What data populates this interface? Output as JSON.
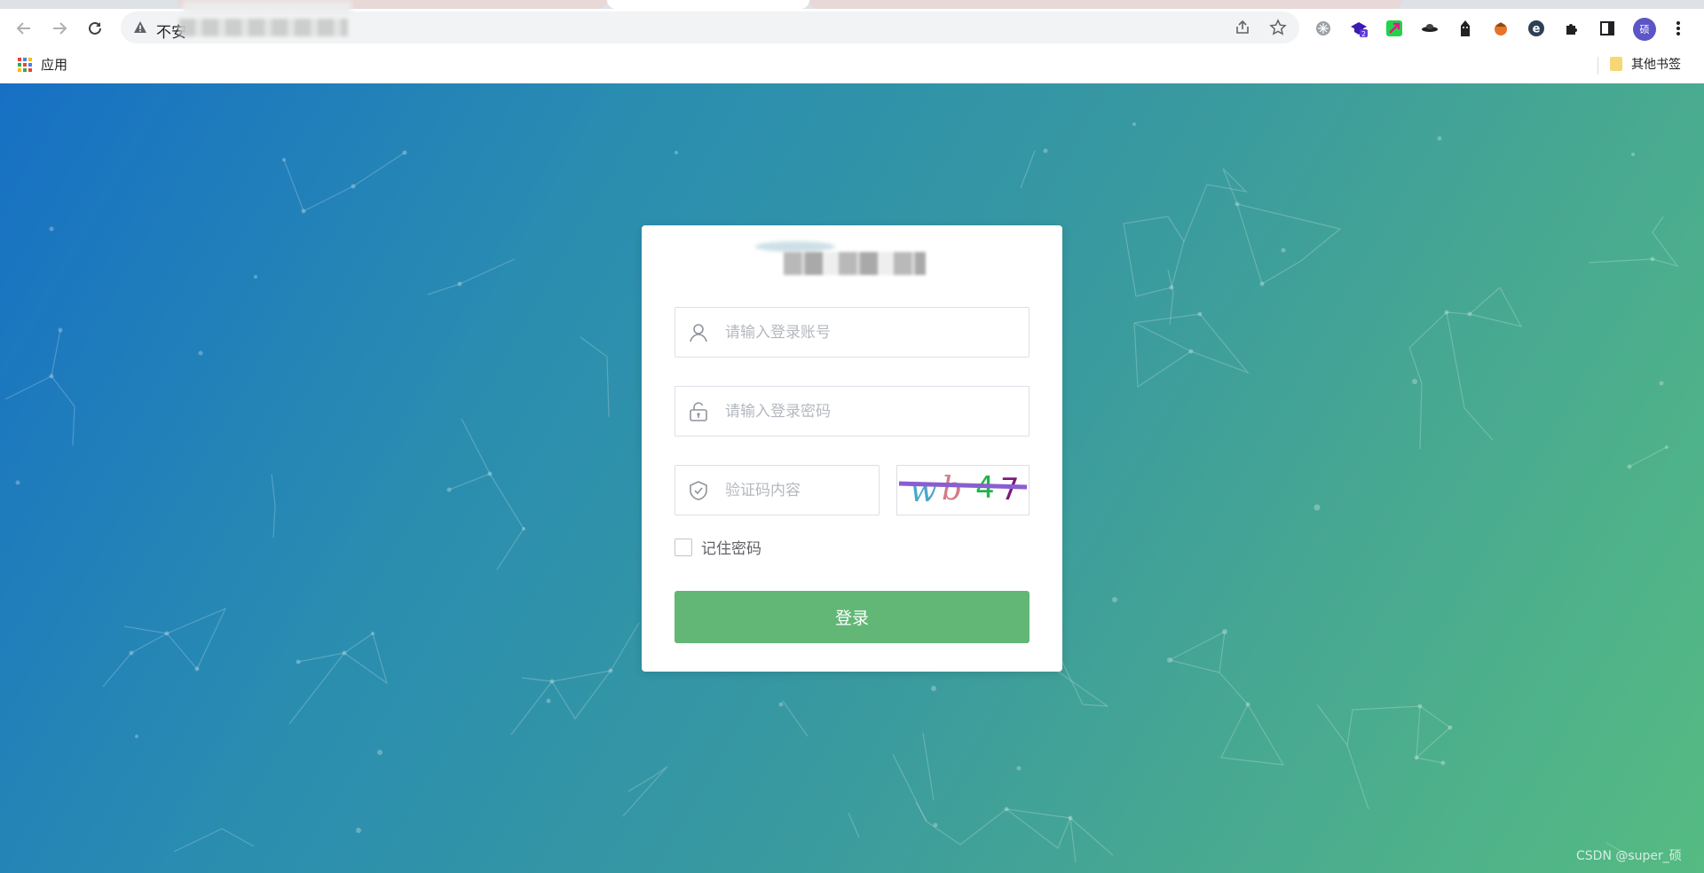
{
  "browser": {
    "omnibox": {
      "security_text": "不安",
      "icons": [
        "warning-icon",
        "share-icon",
        "star-icon"
      ]
    },
    "extensions": [
      "snowflake-icon",
      "badge-extension-icon",
      "arrow-extension-icon",
      "saucer-icon",
      "hacker-icon",
      "hat-icon",
      "e-extension-icon",
      "puzzle-icon",
      "sidepanel-icon"
    ],
    "extension_badge": "2",
    "profile_initial": "硕",
    "bookmarks": {
      "apps_label": "应用",
      "other_label": "其他书签"
    }
  },
  "login": {
    "username_placeholder": "请输入登录账号",
    "password_placeholder": "请输入登录密码",
    "captcha_placeholder": "验证码内容",
    "captcha_text": "wb47",
    "remember_label": "记住密码",
    "submit_label": "登录"
  },
  "colors": {
    "gradient_start": "#1770c4",
    "gradient_end": "#55bb82",
    "button": "#62b776"
  },
  "watermark": "CSDN @super_硕"
}
